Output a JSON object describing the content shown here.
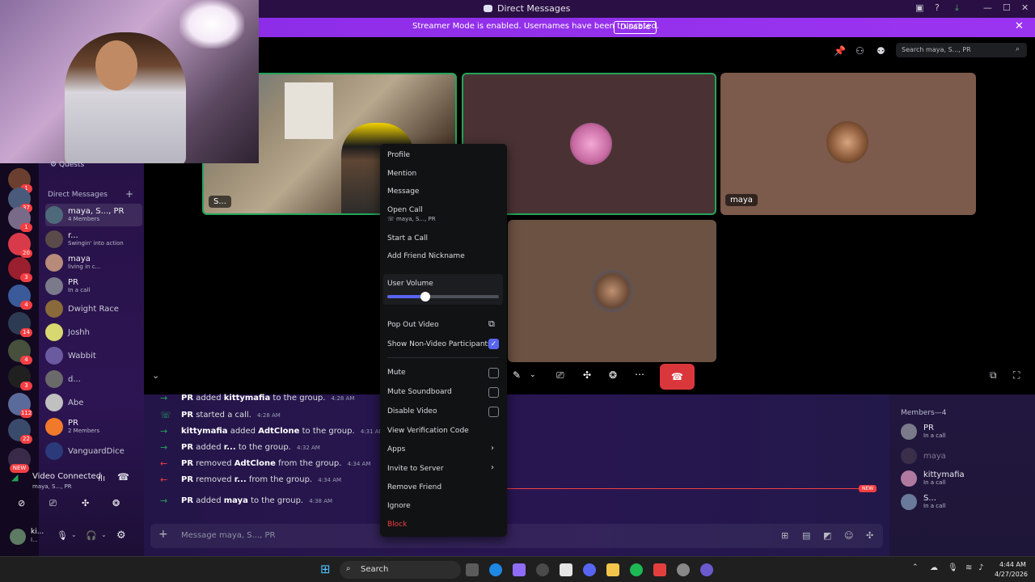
{
  "window": {
    "title": "Direct Messages"
  },
  "banner": {
    "text": "Streamer Mode is enabled. Usernames have been truncated.",
    "button": "Disable"
  },
  "rail": {
    "badges": [
      "1",
      "37",
      "1",
      "20",
      "3",
      "4",
      "14",
      "4",
      "3",
      "112",
      "22",
      "NEW"
    ]
  },
  "sidebar": {
    "quests": "Quests",
    "dm_header": "Direct Messages",
    "dms": [
      {
        "name": "maya, S..., PR",
        "sub": "4 Members"
      },
      {
        "name": "r...",
        "sub": "Swingin' into action"
      },
      {
        "name": "maya",
        "sub": "living in c..."
      },
      {
        "name": "PR",
        "sub": "In a call"
      },
      {
        "name": "Dwight Race"
      },
      {
        "name": "Joshh"
      },
      {
        "name": "Wabbit"
      },
      {
        "name": "d..."
      },
      {
        "name": "Abe"
      },
      {
        "name": "PR",
        "sub": "2 Members"
      },
      {
        "name": "VanguardDice"
      }
    ]
  },
  "voice": {
    "status": "Video Connected",
    "channel": "maya, S..., PR"
  },
  "userbar": {
    "name": "ki...",
    "sub": "I..."
  },
  "header": {
    "search_placeholder": "Search maya, S..., PR"
  },
  "tiles": [
    {
      "label": "S..."
    },
    {
      "label": ""
    },
    {
      "label": "maya"
    },
    {
      "label": ""
    }
  ],
  "chat": {
    "messages": [
      {
        "type": "join",
        "actor": "PR",
        "text": "added",
        "target": "kittymafia",
        "tail": "to the group.",
        "time": "4:28 AM"
      },
      {
        "type": "call",
        "actor": "PR",
        "text": "started a call.",
        "target": "",
        "tail": "",
        "time": "4:28 AM"
      },
      {
        "type": "join",
        "actor": "kittymafia",
        "text": "added",
        "target": "AdtClone",
        "tail": "to the group.",
        "time": "4:31 AM"
      },
      {
        "type": "join",
        "actor": "PR",
        "text": "added",
        "target": "r...",
        "tail": "to the group.",
        "time": "4:32 AM"
      },
      {
        "type": "leave",
        "actor": "PR",
        "text": "removed",
        "target": "AdtClone",
        "tail": "from the group.",
        "time": "4:34 AM"
      },
      {
        "type": "leave",
        "actor": "PR",
        "text": "removed",
        "target": "r...",
        "tail": "from the group.",
        "time": "4:34 AM"
      },
      {
        "type": "join",
        "actor": "PR",
        "text": "added",
        "target": "maya",
        "tail": "to the group.",
        "time": "4:38 AM"
      }
    ],
    "new_badge": "NEW",
    "input_placeholder": "Message maya, S..., PR"
  },
  "members": {
    "header": "Members—4",
    "list": [
      {
        "name": "PR",
        "sub": "In a call"
      },
      {
        "name": "maya",
        "sub": ""
      },
      {
        "name": "kittymafia",
        "sub": "In a call"
      },
      {
        "name": "S...",
        "sub": "In a call"
      }
    ]
  },
  "context_menu": {
    "profile": "Profile",
    "mention": "Mention",
    "message": "Message",
    "open_call": "Open Call",
    "open_call_sub": "maya, S..., PR",
    "start_call": "Start a Call",
    "add_nickname": "Add Friend Nickname",
    "user_volume": "User Volume",
    "volume_level": 0.34,
    "pop_out": "Pop Out Video",
    "show_non_video": "Show Non-Video Participants",
    "show_non_video_checked": true,
    "mute": "Mute",
    "mute_soundboard": "Mute Soundboard",
    "disable_video": "Disable Video",
    "verification": "View Verification Code",
    "apps": "Apps",
    "invite": "Invite to Server",
    "remove_friend": "Remove Friend",
    "ignore": "Ignore",
    "block": "Block"
  },
  "taskbar": {
    "search": "Search",
    "time": "4:44 AM",
    "date": "4/27/2026"
  },
  "colors": {
    "accent": "#5865f2",
    "danger": "#f23f43",
    "banner": "#9b34f0",
    "online": "#23a55a"
  }
}
